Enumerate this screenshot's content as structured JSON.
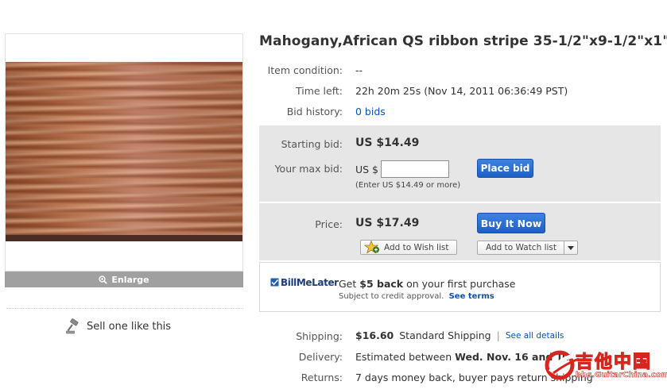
{
  "item": {
    "title": "Mahogany,African QS ribbon stripe 35-1/2\"x9-1/2\"x1\"",
    "enlarge_label": "Enlarge",
    "sell_one_label": "Sell one like this"
  },
  "details": {
    "condition_label": "Item condition:",
    "condition_value": "--",
    "time_left_label": "Time left:",
    "time_left_value": "22h 20m 25s (Nov 14, 2011 06:36:49 PST)",
    "bid_history_label": "Bid history:",
    "bid_history_value": "0 bids"
  },
  "bidding": {
    "starting_bid_label": "Starting bid:",
    "starting_bid_value": "US $14.49",
    "max_bid_label": "Your max bid:",
    "max_bid_currency": "US $",
    "max_bid_input_value": "",
    "max_bid_hint": "(Enter US $14.49 or more)",
    "place_bid_label": "Place bid"
  },
  "buy_now": {
    "price_label": "Price:",
    "price_value": "US $17.49",
    "buy_it_now_label": "Buy It Now",
    "wish_list_label": "Add to Wish list",
    "watch_list_label": "Add to Watch list"
  },
  "bill_me_later": {
    "logo_text": "BillMeLater",
    "offer_prefix": "Get ",
    "offer_amount": "$5 back",
    "offer_suffix": " on your first purchase",
    "approval_text": "Subject to credit approval.",
    "see_terms_label": "See terms"
  },
  "shipping": {
    "shipping_label": "Shipping:",
    "shipping_cost": "$16.60",
    "shipping_method": "Standard Shipping",
    "see_all_details_label": "See all details",
    "delivery_label": "Delivery:",
    "delivery_prefix": "Estimated between ",
    "delivery_dates": "Wed. Nov. 16 and Tu",
    "returns_label": "Returns:",
    "returns_value": "7 days money back, buyer pays return shipping"
  },
  "watermark": {
    "text_cn": "吉他中国",
    "text_url": "bbs.GuitarChina.com"
  },
  "colors": {
    "link": "#0654ba",
    "button_blue": "#1f5fc5",
    "panel_grey": "#e6e6e6",
    "watermark_red": "#d7261e"
  }
}
